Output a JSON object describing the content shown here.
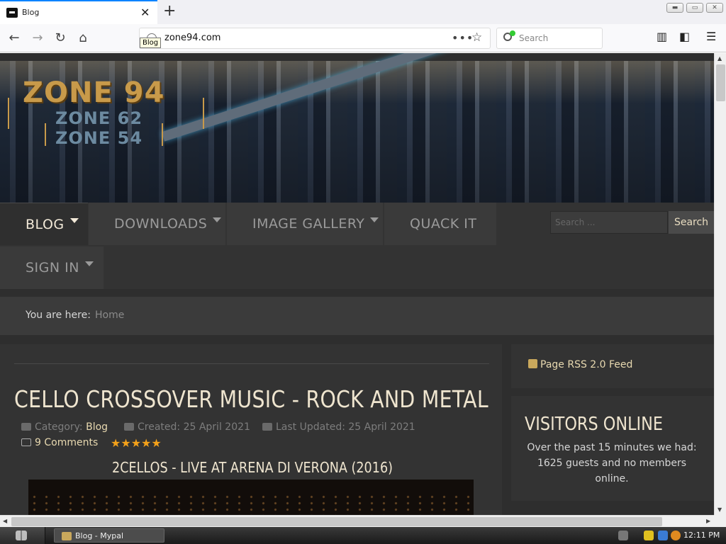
{
  "browser": {
    "tab_title": "Blog",
    "tooltip": "Blog",
    "url": "zone94.com",
    "search_placeholder": "Search"
  },
  "site": {
    "logo_main": "ZONE 94",
    "logo_sub1": "ZONE 62",
    "logo_sub2": "ZONE 54",
    "menu": {
      "blog": "BLOG",
      "downloads": "DOWNLOADS",
      "image_gallery": "IMAGE GALLERY",
      "quack_it": "QUACK IT",
      "sign_in": "SIGN IN"
    },
    "search_placeholder": "Search ...",
    "search_button": "Search",
    "breadcrumb_label": "You are here:",
    "breadcrumb_home": "Home"
  },
  "article": {
    "title": "CELLO CROSSOVER MUSIC - ROCK AND METAL",
    "category_label": "Category:",
    "category": "Blog",
    "created": "Created: 25 April 2021",
    "updated": "Last Updated: 25 April 2021",
    "comments": "9 Comments",
    "rating": 5,
    "video_title": "2CELLOS - LIVE AT ARENA DI VERONA (2016)"
  },
  "sidebar": {
    "rss": "Page RSS 2.0 Feed",
    "visitors_heading": "VISITORS ONLINE",
    "visitors_text": "Over the past 15 minutes we had: 1625 guests and no members online."
  },
  "taskbar": {
    "task_label": "Blog - Mypal",
    "clock": "12:11 PM"
  },
  "colors": {
    "page_bg": "#2e2e2e",
    "accent_text": "#e8d9b0",
    "star_color": "#f3a11a",
    "browser_tab_accent": "#0a84ff"
  }
}
